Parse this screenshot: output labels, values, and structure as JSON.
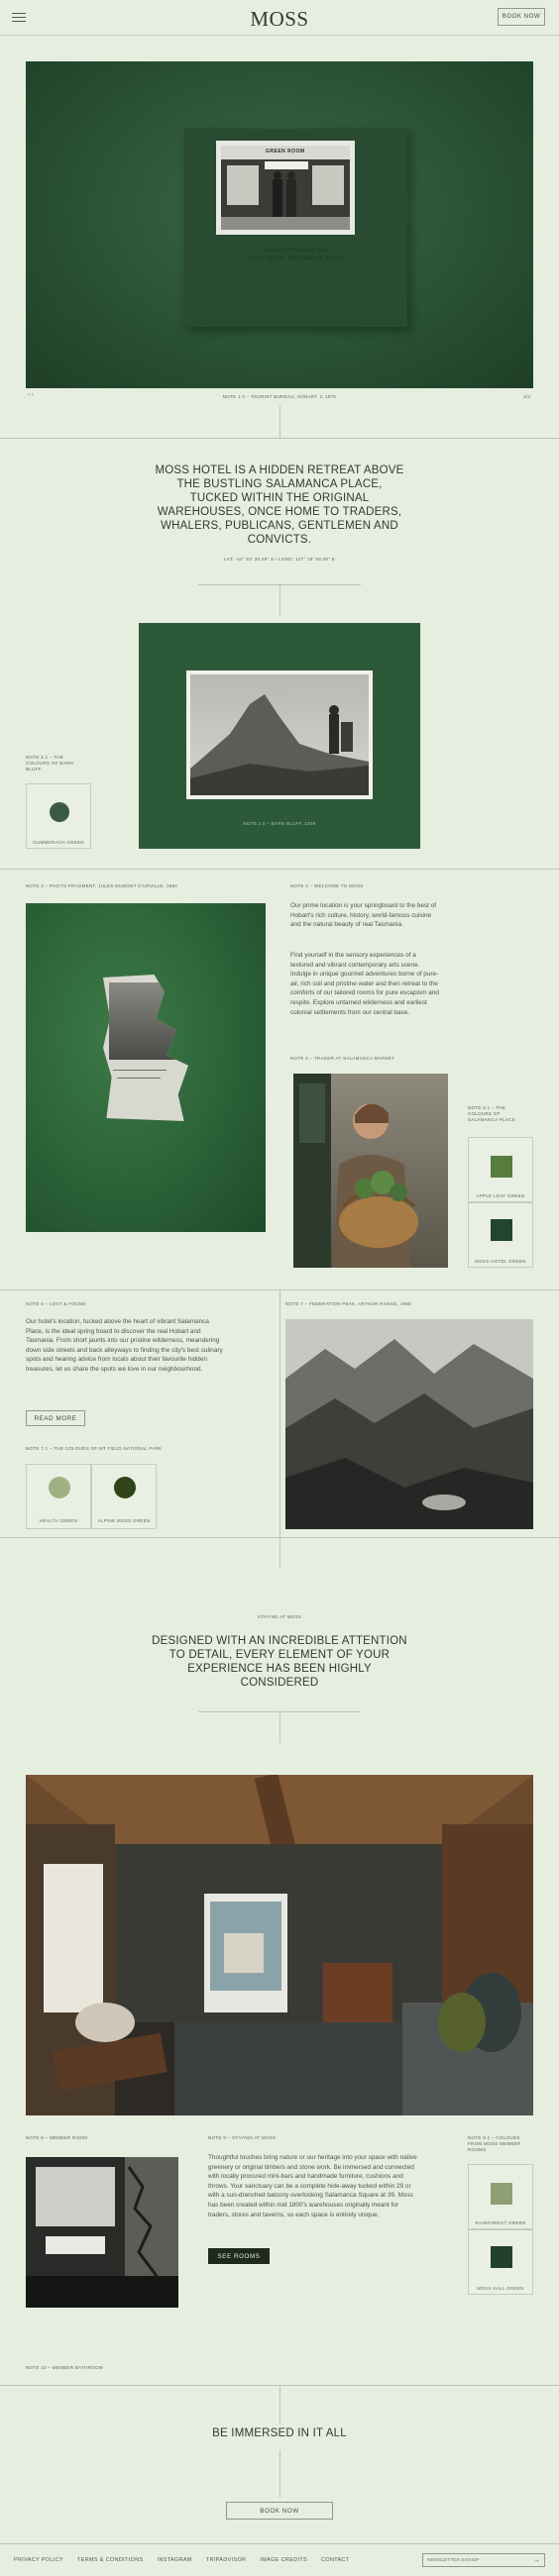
{
  "header": {
    "logo": "MOSS",
    "book_now": "BOOK NOW"
  },
  "hero": {
    "card_text_line1": "ROSS HOTEL AND THE",
    "card_text_line2": "ROOM WAKE, SALAMANCA PLACE",
    "card_sign": "GREEN ROOM",
    "caption": "NOTE 1.0 – TOURIST BUREAU, HOBART, C.1970",
    "pager": "1/3"
  },
  "intro": {
    "heading": "MOSS HOTEL IS A HIDDEN RETREAT ABOVE THE BUSTLING SALAMANCA PLACE, TUCKED WITHIN THE ORIGINAL WAREHOUSES, ONCE HOME TO TRADERS, WHALERS, PUBLICANS, GENTLEMEN AND CONVICTS.",
    "coords": "LAT: -42° 53' 30.48\" S / LONG: 147° 19' 59.05\" E"
  },
  "barn_bluff": {
    "note": "NOTE 2.1 – THE COLOURS OF BARN BLUFF",
    "swatch_label": "GUMMERACH GREEN",
    "swatch_color": "#3b5a45",
    "photo_caption": "NOTE 2.0 – BARN BLUFF, 1939"
  },
  "welcome": {
    "note_left": "NOTE 3 – PHOTO FRAGMENT, JULES DUMONT D'URVILLE, 1884",
    "note_right": "NOTE 4 – WELCOME TO MOSS",
    "para1": "Our prime location is your springboard to the best of Hobart's rich culture, history, world-famous cuisine and the natural beauty of real Tasmania.",
    "para2": "Find yourself in the sensory experiences of a textured and vibrant contemporary arts scene. Indulge in unique gourmet adventures borne of pure-air, rich soil and pristine water and then retreat to the comforts of our tailored rooms for pure escapism and respite. Explore untamed wilderness and earliest colonial settlements from our central base.",
    "trader_note": "NOTE 5 – TRADER AT SALAMANCA MARKET",
    "colours_note": "NOTE 5.1 – THE COLOURS OF SALAMANCA PLACE",
    "swatch1_label": "APPLE LEAF GREEN",
    "swatch1_color": "#567c3e",
    "swatch2_label": "MOSS HOTEL GREEN",
    "swatch2_color": "#23452d"
  },
  "lost_found": {
    "note": "NOTE 6 – LOST & FOUND",
    "para": "Our hotel's location, tucked above the heart of vibrant Salamanca Place, is the ideal spring board to discover the real Hobart and Tasmania. From short jaunts into our pristine wilderness, meandering down side streets and back alleyways to finding the city's best culinary spots and hearing advice from locals about their favourite hidden treasures, let us share the spots we love in our neighbourhood.",
    "read_more": "READ MORE",
    "field_note": "NOTE 7.1 – THE COLOURS OF MT FIELD NATIONAL PARK",
    "swatch1_label": "HEALTH GREEN",
    "swatch1_color": "#9fb182",
    "swatch2_label": "ALPINE MOSS GREEN",
    "swatch2_color": "#2f4418",
    "photo_note": "NOTE 7 – FEDERATION PEAK, ARTHUR RANGE, 1968"
  },
  "staying": {
    "eyebrow": "STAYING AT MOSS",
    "heading": "DESIGNED WITH AN INCREDIBLE ATTENTION TO DETAIL, EVERY ELEMENT OF YOUR EXPERIENCE HAS BEEN HIGHLY CONSIDERED"
  },
  "rooms": {
    "note_left": "NOTE 8 – MEMBER ROOM",
    "note_mid": "NOTE 9 – STAYING AT MOSS",
    "para": "Thoughtful touches bring nature or our heritage into your space with native greenery or original timbers and stone work. Be immersed and connected with locally procured mini-bars and handmade furniture, cushions and throws. Your sanctuary can be a complete hide-away tucked within 29 or with a sun-drenched balcony overlooking Salamanca Square at 39. Moss has been created within mid 1800's warehouses originally meant for traders, stores and taverns, so each space is entirely unique.",
    "see_rooms": "SEE ROOMS",
    "colours_note": "NOTE 9.1 – COLOURS FROM MOSS MEMBER ROOMS",
    "swatch1_label": "RAINFOREST GREEN",
    "swatch1_color": "#8f9f74",
    "swatch2_label": "MOSS HALL GREEN",
    "swatch2_color": "#22412a",
    "bathroom_note": "NOTE 10 – MEMBER BATHROOM"
  },
  "immersed": {
    "heading": "BE IMMERSED IN IT ALL",
    "book_now": "BOOK NOW"
  },
  "footer": {
    "links": [
      "PRIVACY POLICY",
      "TERMS & CONDITIONS",
      "INSTAGRAM",
      "TRIPADVISOR",
      "IMAGE CREDITS",
      "CONTACT"
    ],
    "newsletter_placeholder": "NEWSLETTER SIGNUP",
    "arrow": "→"
  }
}
